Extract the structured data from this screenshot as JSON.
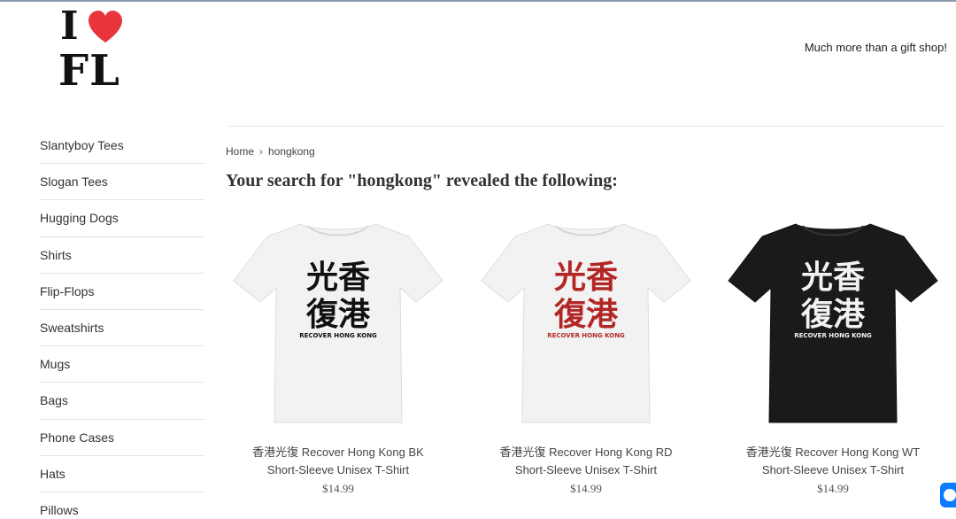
{
  "logo": {
    "line1": "I",
    "line2": "FL",
    "heart_color": "#e8353b"
  },
  "tagline": "Much more than a gift shop!",
  "sidebar": {
    "items": [
      {
        "label": "Slantyboy Tees"
      },
      {
        "label": "Slogan Tees"
      },
      {
        "label": "Hugging Dogs"
      },
      {
        "label": "Shirts"
      },
      {
        "label": "Flip-Flops"
      },
      {
        "label": "Sweatshirts"
      },
      {
        "label": "Mugs"
      },
      {
        "label": "Bags"
      },
      {
        "label": "Phone Cases"
      },
      {
        "label": "Hats"
      },
      {
        "label": "Pillows"
      }
    ]
  },
  "breadcrumb": {
    "home": "Home",
    "separator": "›",
    "current": "hongkong"
  },
  "search": {
    "title": "Your search for \"hongkong\" revealed the following:"
  },
  "products": [
    {
      "title": "香港光復 Recover Hong Kong BK Short-Sleeve Unisex T-Shirt",
      "price": "$14.99",
      "shirt_color": "#f2f2f2",
      "print_color": "#111111",
      "print_text_top": "光香",
      "print_text_bottom": "復港",
      "print_caption": "RECOVER HONG KONG"
    },
    {
      "title": "香港光復 Recover Hong Kong RD Short-Sleeve Unisex T-Shirt",
      "price": "$14.99",
      "shirt_color": "#f2f2f2",
      "print_color": "#b32626",
      "print_text_top": "光香",
      "print_text_bottom": "復港",
      "print_caption": "RECOVER HONG KONG"
    },
    {
      "title": "香港光復 Recover Hong Kong WT Short-Sleeve Unisex T-Shirt",
      "price": "$14.99",
      "shirt_color": "#1a1a1a",
      "print_color": "#f2f2f2",
      "print_text_top": "光香",
      "print_text_bottom": "復港",
      "print_caption": "RECOVER HONG KONG"
    }
  ]
}
